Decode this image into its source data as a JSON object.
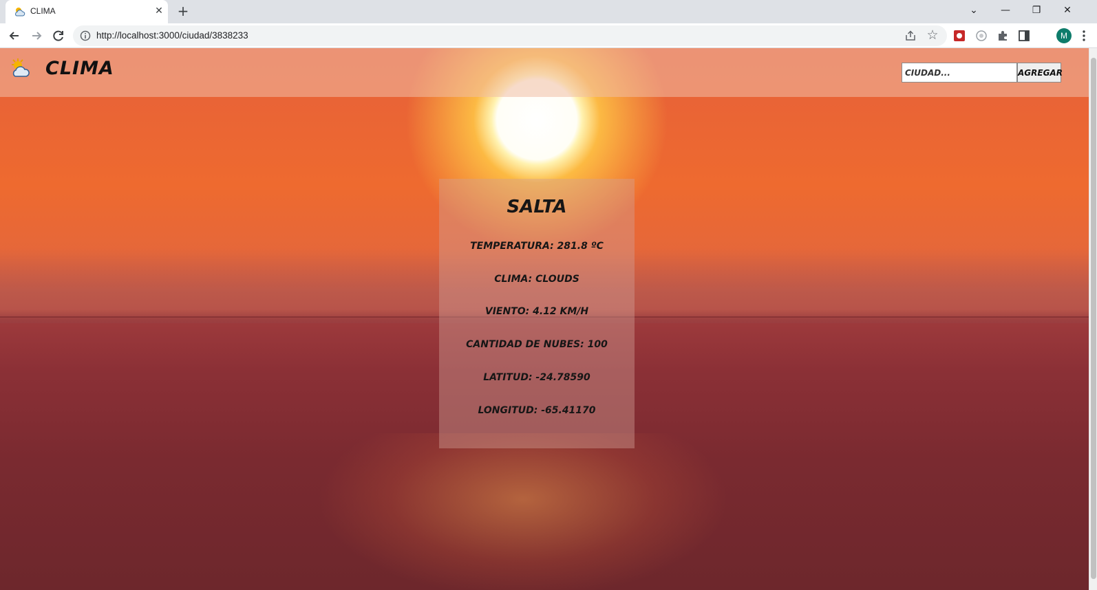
{
  "browser": {
    "tab_title": "CLIMA",
    "url": "http://localhost:3000/ciudad/3838233",
    "profile_initial": "M"
  },
  "app": {
    "brand": "CLIMA",
    "search": {
      "placeholder": "CIUDAD...",
      "value": ""
    },
    "add_label": "AGREGAR"
  },
  "city": {
    "name": "SALTA",
    "temperature": "TEMPERATURA: 281.8 ºC",
    "weather": "CLIMA: CLOUDS",
    "wind": "VIENTO: 4.12 KM/H",
    "clouds": "CANTIDAD DE NUBES: 100",
    "latitude": "LATITUD: -24.78590",
    "longitude": "LONGITUD: -65.41170"
  },
  "colors": {
    "navbar": "#f0bea5",
    "card": "#d2a096",
    "profile": "#0e7c6b"
  },
  "icons": {
    "logo": "sun-cloud-icon",
    "tab_favicon": "sun-cloud-icon"
  }
}
